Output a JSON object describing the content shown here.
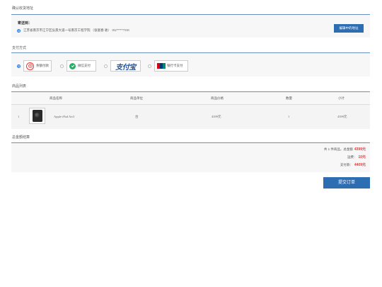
{
  "address_section": {
    "title": "确认收货地址",
    "recipient_label": "寄送到：",
    "address_text": "江苏省南京市江宁区弘景大道一号南京工程学院 （张富春 收） 182****7538",
    "edit_button": "编辑中的地址"
  },
  "payment_section": {
    "title": "支付方式",
    "options": [
      {
        "label": "余额付款",
        "selected": true,
        "icon": "balance-pay-icon",
        "color": "#e4393c"
      },
      {
        "label": "微信支付",
        "selected": false,
        "icon": "wechat-pay-icon",
        "color": "#2aae67"
      },
      {
        "label": "支付宝",
        "selected": false,
        "icon": "alipay-icon",
        "color": "#1a4fa0"
      },
      {
        "label": "银行卡支付",
        "selected": false,
        "icon": "unionpay-icon",
        "color": "#d7000f"
      }
    ]
  },
  "products_section": {
    "title": "商品列表",
    "headers": [
      "商品名称",
      "商品单位",
      "商品价格",
      "数量",
      "小计"
    ],
    "rows": [
      {
        "index": "1",
        "name": "Apple iPad Air3",
        "unit": "台",
        "price": "4399元",
        "qty": "1",
        "subtotal": "4399元"
      }
    ]
  },
  "settlement_section": {
    "title": "总金额结算",
    "summary_prefix": "共 1 件商品，总金额",
    "summary_amount": "4399元",
    "freight_label": "运费：",
    "freight_amount": "10元",
    "payable_label": "支付款：",
    "payable_amount": "4409元"
  },
  "submit_button": "提交订单",
  "colors": {
    "accent": "#2d6db2",
    "price": "#e4393c",
    "panel": "#f7f7f7"
  }
}
